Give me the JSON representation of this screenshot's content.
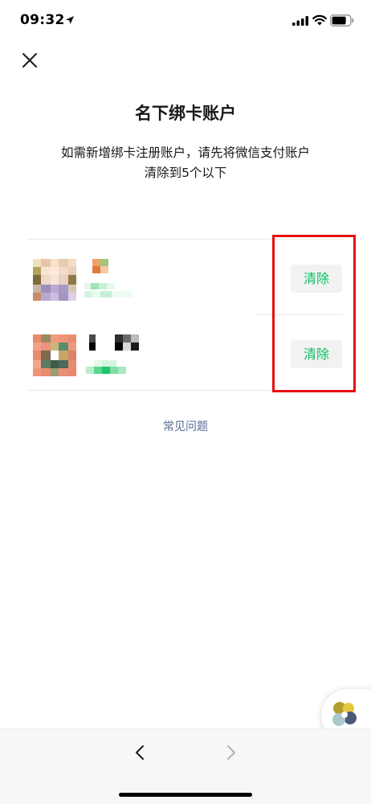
{
  "status_bar": {
    "time": "09:32"
  },
  "page": {
    "title": "名下绑卡账户",
    "description_line1": "如需新增绑卡注册账户，请先将微信支付账户",
    "description_line2": "清除到5个以下"
  },
  "accounts": [
    {
      "clear_label": "清除"
    },
    {
      "clear_label": "清除"
    }
  ],
  "faq_label": "常见问题",
  "colors": {
    "accent": "#07c160",
    "link": "#576b95",
    "highlight": "#e61010"
  },
  "icons": {
    "close": "close-icon",
    "back": "chevron-left-icon",
    "forward": "chevron-right-icon",
    "widget": "mini-program-icon"
  }
}
